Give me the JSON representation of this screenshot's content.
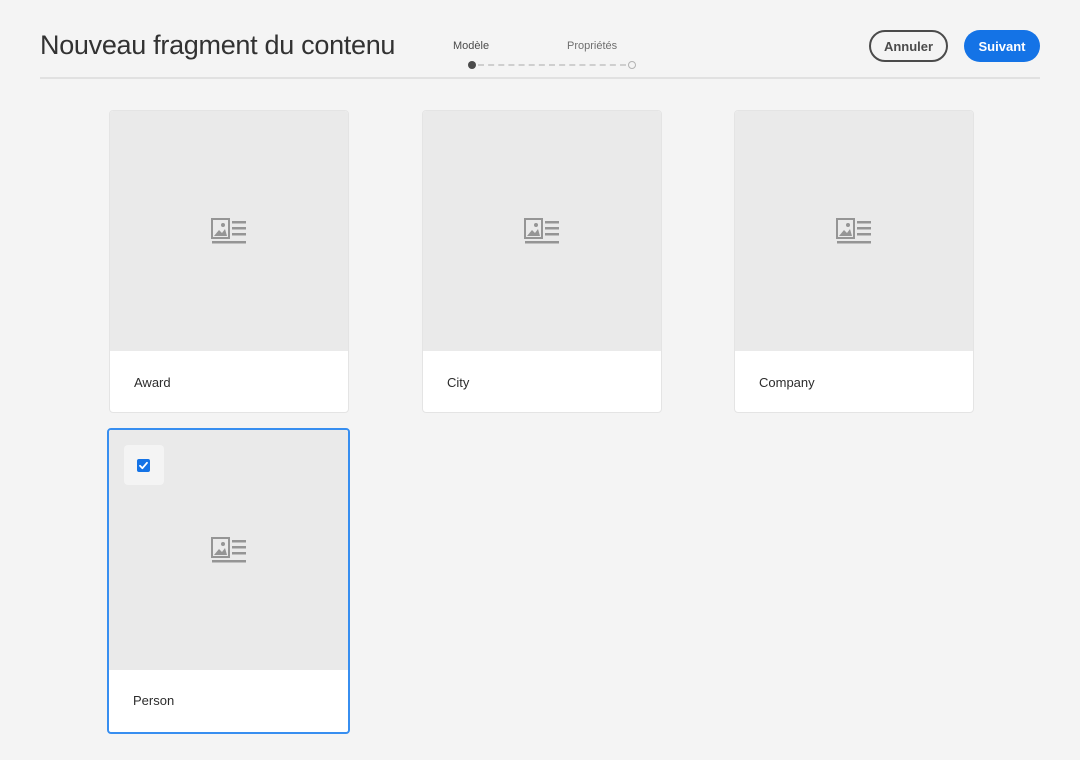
{
  "header": {
    "title": "Nouveau fragment du contenu",
    "steps": [
      {
        "label": "Modèle",
        "state": "current"
      },
      {
        "label": "Propriétés",
        "state": "upcoming"
      }
    ],
    "cancel_label": "Annuler",
    "next_label": "Suivant"
  },
  "models": [
    {
      "label": "Award",
      "selected": false,
      "icon": "image-text-icon"
    },
    {
      "label": "City",
      "selected": false,
      "icon": "image-text-icon"
    },
    {
      "label": "Company",
      "selected": false,
      "icon": "image-text-icon"
    },
    {
      "label": "Person",
      "selected": true,
      "icon": "image-text-icon"
    }
  ],
  "colors": {
    "accent": "#1473e6",
    "selection_border": "#378ef0",
    "background": "#f4f4f4",
    "thumbnail": "#eaeaea",
    "icon": "#959595"
  }
}
